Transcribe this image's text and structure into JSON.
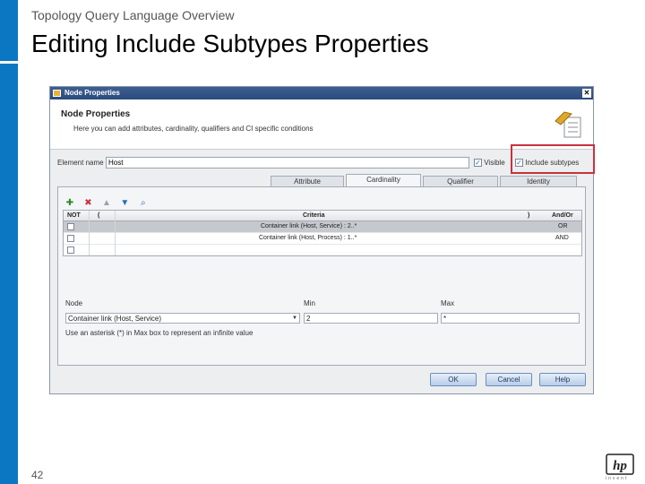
{
  "slide": {
    "subtitle": "Topology Query Language Overview",
    "title": "Editing Include Subtypes Properties",
    "page_number": "42",
    "logo_text": "hp",
    "logo_subtext": "invent"
  },
  "dialog": {
    "window_title": "Node Properties",
    "close_glyph": "✕",
    "header_title": "Node Properties",
    "header_description": "Here you can add attributes, cardinality, qualifiers and CI specific conditions",
    "element_name_label": "Element name",
    "element_name_value": "Host",
    "visible_label": "Visible",
    "visible_checked": true,
    "include_subtypes_label": "Include subtypes",
    "include_subtypes_checked": true,
    "tabs": [
      {
        "label": "Attribute",
        "active": false
      },
      {
        "label": "Cardinality",
        "active": true
      },
      {
        "label": "Qualifier",
        "active": false
      },
      {
        "label": "Identity",
        "active": false
      }
    ],
    "toolbar": [
      "add-icon",
      "delete-icon",
      "move-up-icon",
      "move-down-icon",
      "find-icon"
    ],
    "grid": {
      "columns": {
        "not": "NOT",
        "open_paren": "(",
        "criteria": "Criteria",
        "close_paren": ")",
        "and_or": "And/Or"
      },
      "rows": [
        {
          "criteria": "Container link (Host, Service) : 2..*",
          "and_or": "OR",
          "selected": true
        },
        {
          "criteria": "Container link (Host, Process) : 1..*",
          "and_or": "AND",
          "selected": false
        },
        {
          "criteria": "",
          "and_or": "",
          "selected": false
        }
      ]
    },
    "node_label": "Node",
    "node_value": "Container link (Host, Service)",
    "min_label": "Min",
    "min_value": "2",
    "max_label": "Max",
    "max_value": "*",
    "hint": "Use an asterisk (*) in Max box to represent an infinite value",
    "buttons": {
      "ok": "OK",
      "cancel": "Cancel",
      "help": "Help"
    }
  },
  "colors": {
    "sidebar": "#0b77c2",
    "highlight": "#c8323d",
    "selected_row": "#c5c8cd"
  }
}
